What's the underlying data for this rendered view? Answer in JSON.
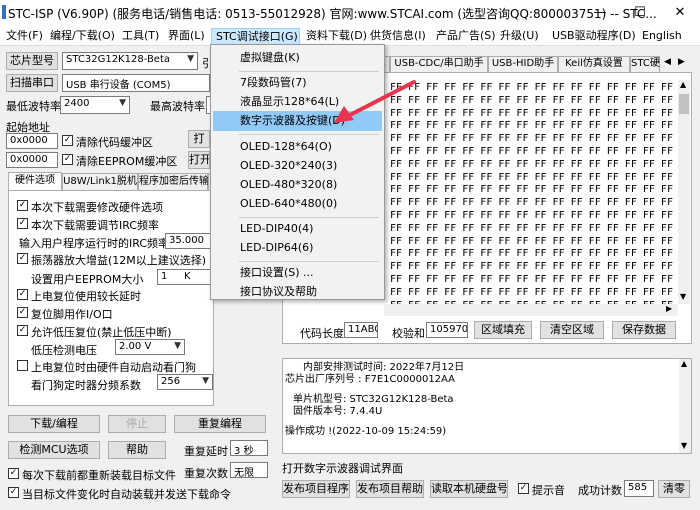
{
  "title": "STC-ISP (V6.90P) (服务电话/销售电话: 0513-55012928) 官网:www.STCAI.com  (选型咨询QQ:800003751) -- STC...",
  "window": {
    "minimize": "—",
    "maximize": "☐",
    "close": "✕"
  },
  "menu": [
    "文件(F)",
    "编程/下载(O)",
    "工具(T)",
    "界面(L)",
    "STC调试接口(G)",
    "资料下载(D)",
    "供货信息(I)",
    "产品广告(S)",
    "升级(U)",
    "USB驱动程序(D)",
    "English"
  ],
  "left": {
    "chip_btn": "芯片型号",
    "chip_value": "STC32G12K128-Beta",
    "chip_suffix": "引",
    "scan_btn": "扫描串口",
    "port_value": "USB 串行设备 (COM5)",
    "min_baud_label": "最低波特率",
    "min_baud": "2400",
    "max_baud_label": "最高波特率",
    "start_addr_label": "起始地址",
    "addr1": "0x0000",
    "clear_code": "清除代码缓冲区",
    "open1": "打",
    "addr2": "0x0000",
    "clear_eeprom": "清除EEPROM缓冲区",
    "open2": "打开"
  },
  "opt_tabs": [
    "硬件选项",
    "U8W/Link1脱机",
    "程序加密后传输",
    "I"
  ],
  "options": {
    "o1": "本次下载需要修改硬件选项",
    "o2": "本次下载需要调节IRC频率",
    "irc_label": "输入用户程序运行时的IRC频率",
    "irc_value": "35.000",
    "o3": "振荡器放大增益(12M以上建议选择)",
    "eeprom_label": "设置用户EEPROM大小",
    "eeprom_value": "1",
    "eeprom_unit": "K",
    "o4": "上电复位使用较长延时",
    "o5": "复位脚用作I/O口",
    "o6": "允许低压复位(禁止低压中断)",
    "lv_label": "低压检测电压",
    "lv_value": "2.00 V",
    "o7": "上电复位时由硬件自动启动看门狗",
    "wd_label": "看门狗定时器分频系数",
    "wd_value": "256"
  },
  "bottom_left": {
    "download": "下载/编程",
    "stop": "停止",
    "reprogram": "重复编程",
    "detect": "检测MCU选项",
    "help": "帮助",
    "delay_label": "重复延时",
    "delay_value": "3 秒",
    "count_label": "重复次数",
    "count_value": "无限",
    "c1": "每次下载前都重新装载目标文件",
    "c2": "当目标文件变化时自动装载并发送下载命令"
  },
  "right_tabs": [
    "仿真",
    "USB-CDC/串口助手",
    "USB-HID助手",
    "Keil仿真设置",
    "STC硬"
  ],
  "hex_row": "FF FF FF FF FF FF FF FF FF FF FF FF FF FF FF FF",
  "code_stats": {
    "len_label": "代码长度",
    "len_value": "11AB0",
    "chk_label": "校验和",
    "chk_value": "1059701",
    "fill": "区域填充",
    "clear": "清空区域",
    "save": "保存数据"
  },
  "log": {
    "l1": "内部安排测试时间: 2022年7月12日",
    "l2": "芯片出厂序列号 : F7E1C0000012AA",
    "l3": "单片机型号: STC32G12K128-Beta",
    "l4": "固件版本号: 7.4.4U",
    "l5": "操作成功 !(2022-10-09 15:24:59)"
  },
  "status": "打开数字示波器调试界面",
  "bottom_right": {
    "publish": "发布项目程序",
    "publish_help": "发布项目帮助",
    "read_id": "读取本机硬盘号",
    "beep": "提示音",
    "success_label": "成功计数",
    "success_value": "585",
    "clear": "清零"
  },
  "dropdown": [
    {
      "label": "虚拟键盘(K)"
    },
    {
      "label": "7段数码管(7)"
    },
    {
      "label": "液晶显示128*64(L)"
    },
    {
      "label": "数字示波器及按键(D)"
    },
    {
      "label": "OLED-128*64(O)"
    },
    {
      "label": "OLED-320*240(3)"
    },
    {
      "label": "OLED-480*320(8)"
    },
    {
      "label": "OLED-640*480(0)"
    },
    {
      "label": "LED-DIP40(4)"
    },
    {
      "label": "LED-DIP64(6)"
    },
    {
      "label": "接口设置(S) ..."
    },
    {
      "label": "接口协议及帮助"
    }
  ],
  "colors": {
    "accent_arrow": "#e8344e",
    "highlight": "#91c9f7"
  }
}
